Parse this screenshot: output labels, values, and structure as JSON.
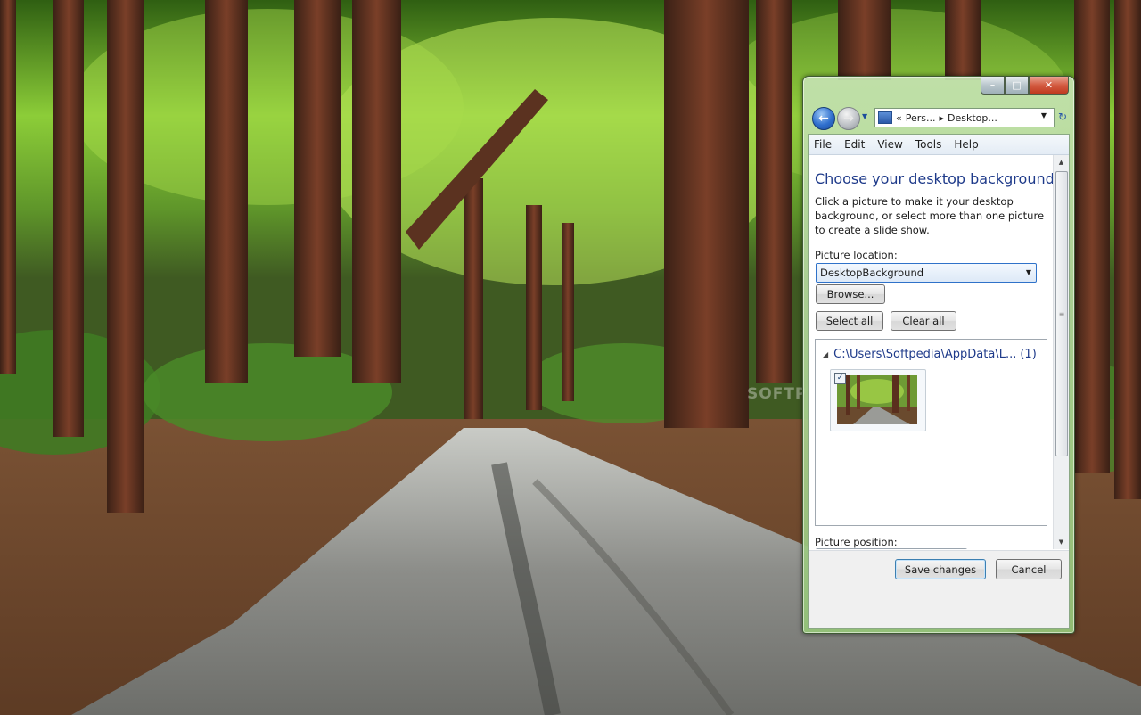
{
  "window": {
    "caption_buttons": {
      "minimize": "–",
      "maximize": "□",
      "close": "✕"
    },
    "address": {
      "prefix": "«",
      "crumbs": [
        "Pers...",
        "Desktop..."
      ],
      "separator": "▸"
    },
    "menu": [
      "File",
      "Edit",
      "View",
      "Tools",
      "Help"
    ]
  },
  "page": {
    "title": "Choose your desktop background",
    "description": "Click a picture to make it your desktop background, or select more than one picture to create a slide show.",
    "location_label": "Picture location:",
    "location_value": "DesktopBackground",
    "browse_label": "Browse...",
    "select_all_label": "Select all",
    "clear_all_label": "Clear all",
    "group_header": "C:\\Users\\Softpedia\\AppData\\L...",
    "group_count": "(1)",
    "thumbnail_checked": true,
    "position_label": "Picture position:",
    "save_label": "Save changes",
    "cancel_label": "Cancel"
  },
  "icons": {
    "back": "back-arrow-icon",
    "forward": "forward-arrow-icon",
    "refresh": "refresh-icon",
    "folder": "personalization-folder-icon",
    "dropdown": "chevron-down-icon",
    "scroll": "scroll-grip-icon"
  },
  "colors": {
    "title_blue": "#1e3a8a",
    "window_frame": "#a8d294",
    "close_red": "#c0391f",
    "default_button_border": "#3c7fb1"
  },
  "watermark": "SOFTPEDIA"
}
